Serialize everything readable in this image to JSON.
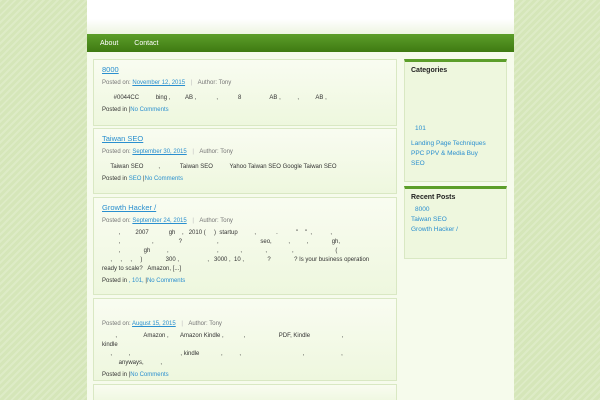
{
  "nav": {
    "items": [
      "About",
      "Contact"
    ]
  },
  "posts": [
    {
      "title": "8000",
      "posted_on_label": "Posted on:",
      "date": "November 12, 2015",
      "author_label": "Author:",
      "author": "Tony",
      "excerpt": "       #0044CC          bing ,         AB ,            ,            8                 AB ,          ,          AB ,",
      "posted_in_label": "Posted in",
      "categories": "",
      "comments": "No Comments"
    },
    {
      "title": "Taiwan SEO",
      "posted_on_label": "Posted on:",
      "date": "September 30, 2015",
      "author_label": "Author:",
      "author": "Tony",
      "excerpt": "     Taiwan SEO         ,            Taiwan SEO          Yahoo Taiwan SEO Google Taiwan SEO",
      "posted_in_label": "Posted in",
      "categories": "SEO",
      "comments": "No Comments"
    },
    {
      "title": "Growth Hacker /",
      "posted_on_label": "Posted on:",
      "date": "September 24, 2015",
      "author_label": "Author:",
      "author": "Tony",
      "excerpt": "          ,         2007            gh    ,   2010 (     )  startup          ,            .           \"    \"  ,           ,\n          ,                   ,               ?                     ,                         seo,          ,          ,              gh,\n          ,              gh          ,                             ,             ,              ,               ,                         (\n     ,     ,     ,     )              300 ,                 ,   3000 ,  10 ,              ?              ? Is your business operation\nready to scale?   Amazon, [...]",
      "posted_in_label": "Posted in",
      "categories": ", 101,",
      "comments": "No Comments"
    },
    {
      "title": "",
      "posted_on_label": "Posted on:",
      "date": "August 15, 2015",
      "author_label": "Author:",
      "author": "Tony",
      "excerpt": "        ,                Amazon ,       Amazon Kindle ,            ,                    PDF, Kindle                   ,                   kindle\n     ,          ,                              , kindle             ,          ,                                     ,                      ,\n          anyways,          ,",
      "posted_in_label": "Posted in",
      "categories": "",
      "comments": "No Comments"
    }
  ],
  "sidebar": {
    "categories_title": "Categories",
    "categories": [
      "101",
      "Landing Page Techniques",
      "PPC PPV & Media Buy",
      "SEO"
    ],
    "recent_title": "Recent Posts",
    "recent": [
      "8000",
      "Taiwan SEO",
      "Growth Hacker /"
    ]
  }
}
